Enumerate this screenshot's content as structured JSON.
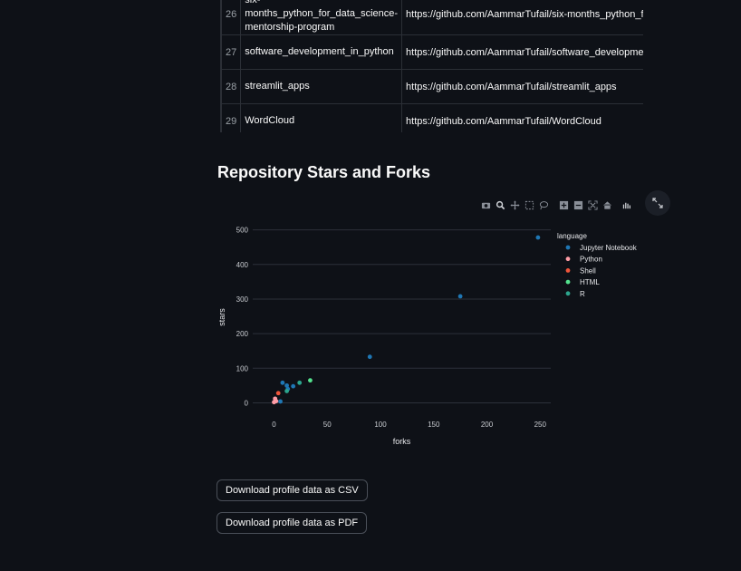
{
  "table": {
    "rows": [
      {
        "index": "26",
        "name": "six-months_python_for_data_science-mentorship-program",
        "url": "https://github.com/AammarTufail/six-months_python_for_data_science-mentorship-program"
      },
      {
        "index": "27",
        "name": "software_development_in_python",
        "url": "https://github.com/AammarTufail/software_development_in_python"
      },
      {
        "index": "28",
        "name": "streamlit_apps",
        "url": "https://github.com/AammarTufail/streamlit_apps"
      },
      {
        "index": "29",
        "name": "WordCloud",
        "url": "https://github.com/AammarTufail/WordCloud"
      }
    ]
  },
  "section_title": "Repository Stars and Forks",
  "modebar_icons": [
    "camera-icon",
    "zoom-icon",
    "pan-icon",
    "box-select-icon",
    "lasso-icon",
    "zoom-in-icon",
    "zoom-out-icon",
    "autoscale-icon",
    "reset-axes-icon",
    "plotly-logo-icon"
  ],
  "chart_data": {
    "type": "scatter",
    "xlabel": "forks",
    "ylabel": "stars",
    "xlim": [
      -20,
      260
    ],
    "ylim": [
      -25,
      520
    ],
    "x_ticks": [
      0,
      50,
      100,
      150,
      200,
      250
    ],
    "y_ticks": [
      0,
      100,
      200,
      300,
      400,
      500
    ],
    "grid": true,
    "legend_title": "language",
    "legend_position": "top-right",
    "series": [
      {
        "name": "Jupyter Notebook",
        "color": "#1f77b4",
        "points": [
          [
            248,
            478
          ],
          [
            175,
            308
          ],
          [
            90,
            133
          ],
          [
            12,
            50
          ],
          [
            18,
            48
          ],
          [
            8,
            58
          ],
          [
            6,
            4
          ],
          [
            13,
            40
          ]
        ]
      },
      {
        "name": "Python",
        "color": "#ff9da6",
        "points": [
          [
            1,
            12
          ],
          [
            2,
            5
          ],
          [
            0,
            2
          ]
        ]
      },
      {
        "name": "Shell",
        "color": "#ef553b",
        "points": [
          [
            4,
            28
          ]
        ]
      },
      {
        "name": "HTML",
        "color": "#54e38e",
        "points": [
          [
            34,
            65
          ]
        ]
      },
      {
        "name": "R",
        "color": "#2ca58d",
        "points": [
          [
            24,
            58
          ],
          [
            12,
            34
          ]
        ]
      }
    ]
  },
  "buttons": {
    "csv": "Download profile data as CSV",
    "pdf": "Download profile data as PDF"
  }
}
